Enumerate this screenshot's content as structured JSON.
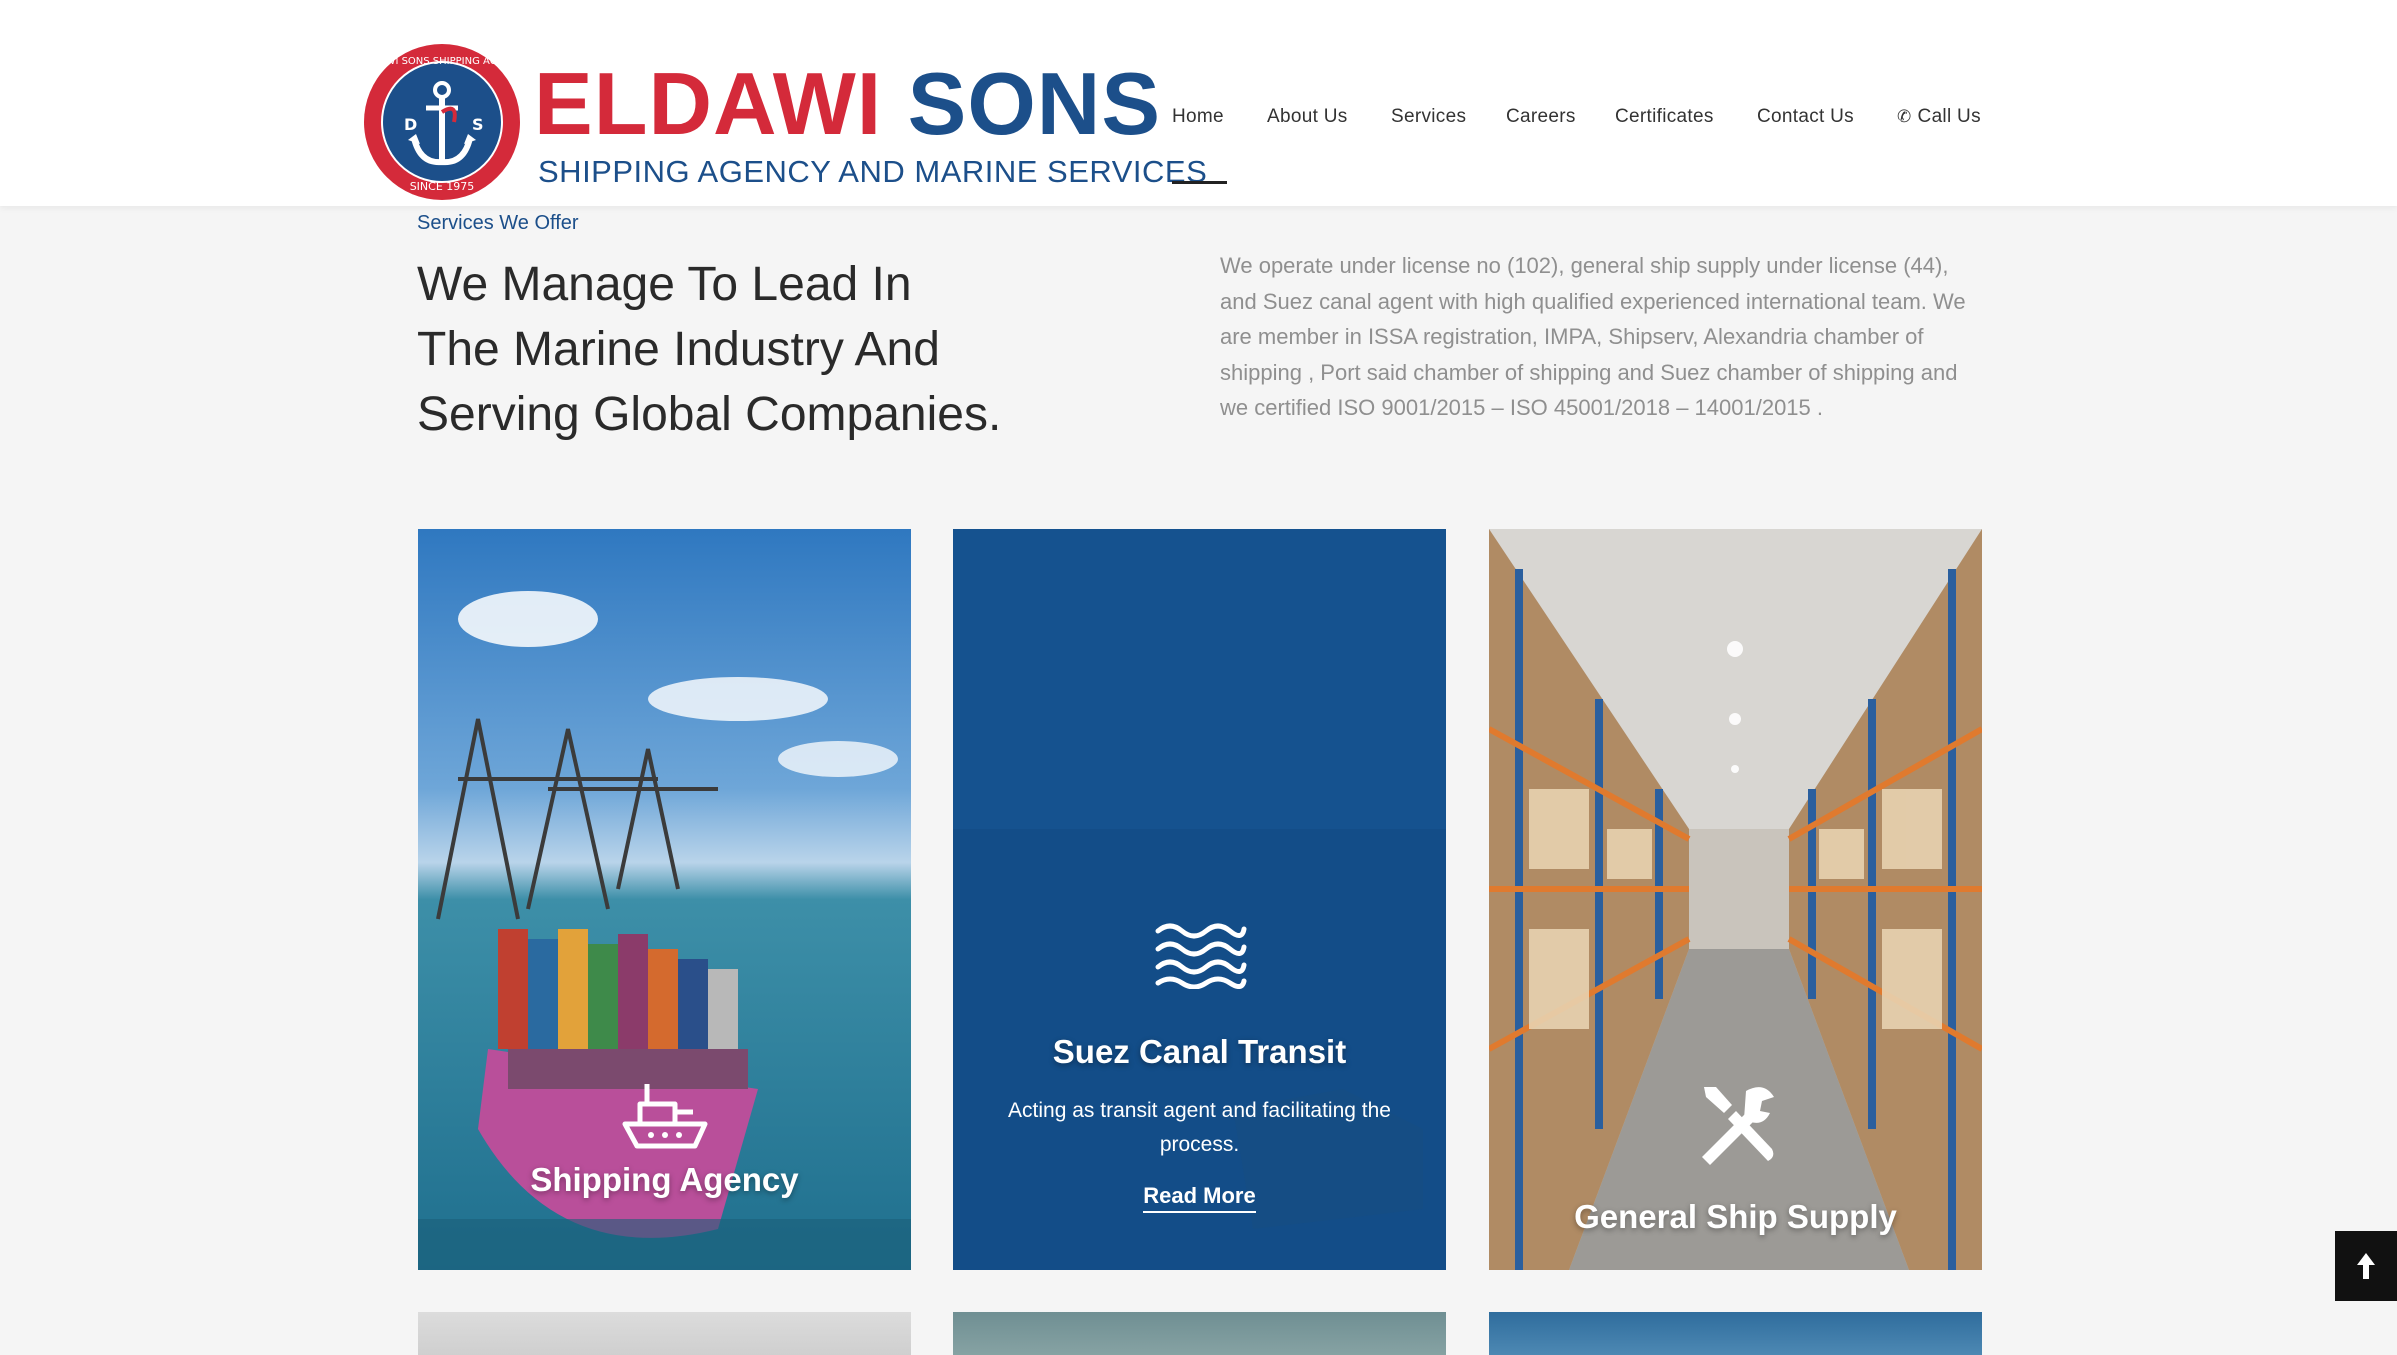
{
  "brand": {
    "name_part1": "ELDAWI",
    "name_part2": "SONS",
    "tagline": "SHIPPING AGENCY AND MARINE SERVICES",
    "seal_text_top": "ELDAWI SONS SHIPPING AGENCY",
    "seal_text_bottom": "SINCE 1975",
    "seal_letter_left": "D",
    "seal_letter_right": "S",
    "colors": {
      "red": "#d42a3a",
      "navy": "#1c4f8a"
    }
  },
  "nav": {
    "items": [
      "Home",
      "About Us",
      "Services",
      "Careers",
      "Certificates",
      "Contact Us"
    ],
    "call_label": "Call Us",
    "active": "Home"
  },
  "intro": {
    "eyebrow": "Services We Offer",
    "headline_lines": [
      "We Manage To Lead In",
      "The Marine Industry And",
      "Serving Global Companies."
    ],
    "body": "We operate under license no (102), general ship supply under license (44), and Suez canal agent with high qualified experienced international team. We are member in ISSA registration, IMPA, Shipserv, Alexandria chamber of shipping , Port said chamber of shipping and Suez chamber of shipping and we certified ISO 9001/2015 – ISO 45001/2018 – 14001/2015 ."
  },
  "cards": [
    {
      "title": "Shipping Agency",
      "icon": "ship-icon"
    },
    {
      "title": "Suez Canal Transit",
      "icon": "waves-icon",
      "description": "Acting as transit agent and facilitating the process.",
      "link": "Read More"
    },
    {
      "title": "General Ship Supply",
      "icon": "tools-icon"
    }
  ],
  "scroll_top": {
    "icon": "arrow-up-icon"
  }
}
